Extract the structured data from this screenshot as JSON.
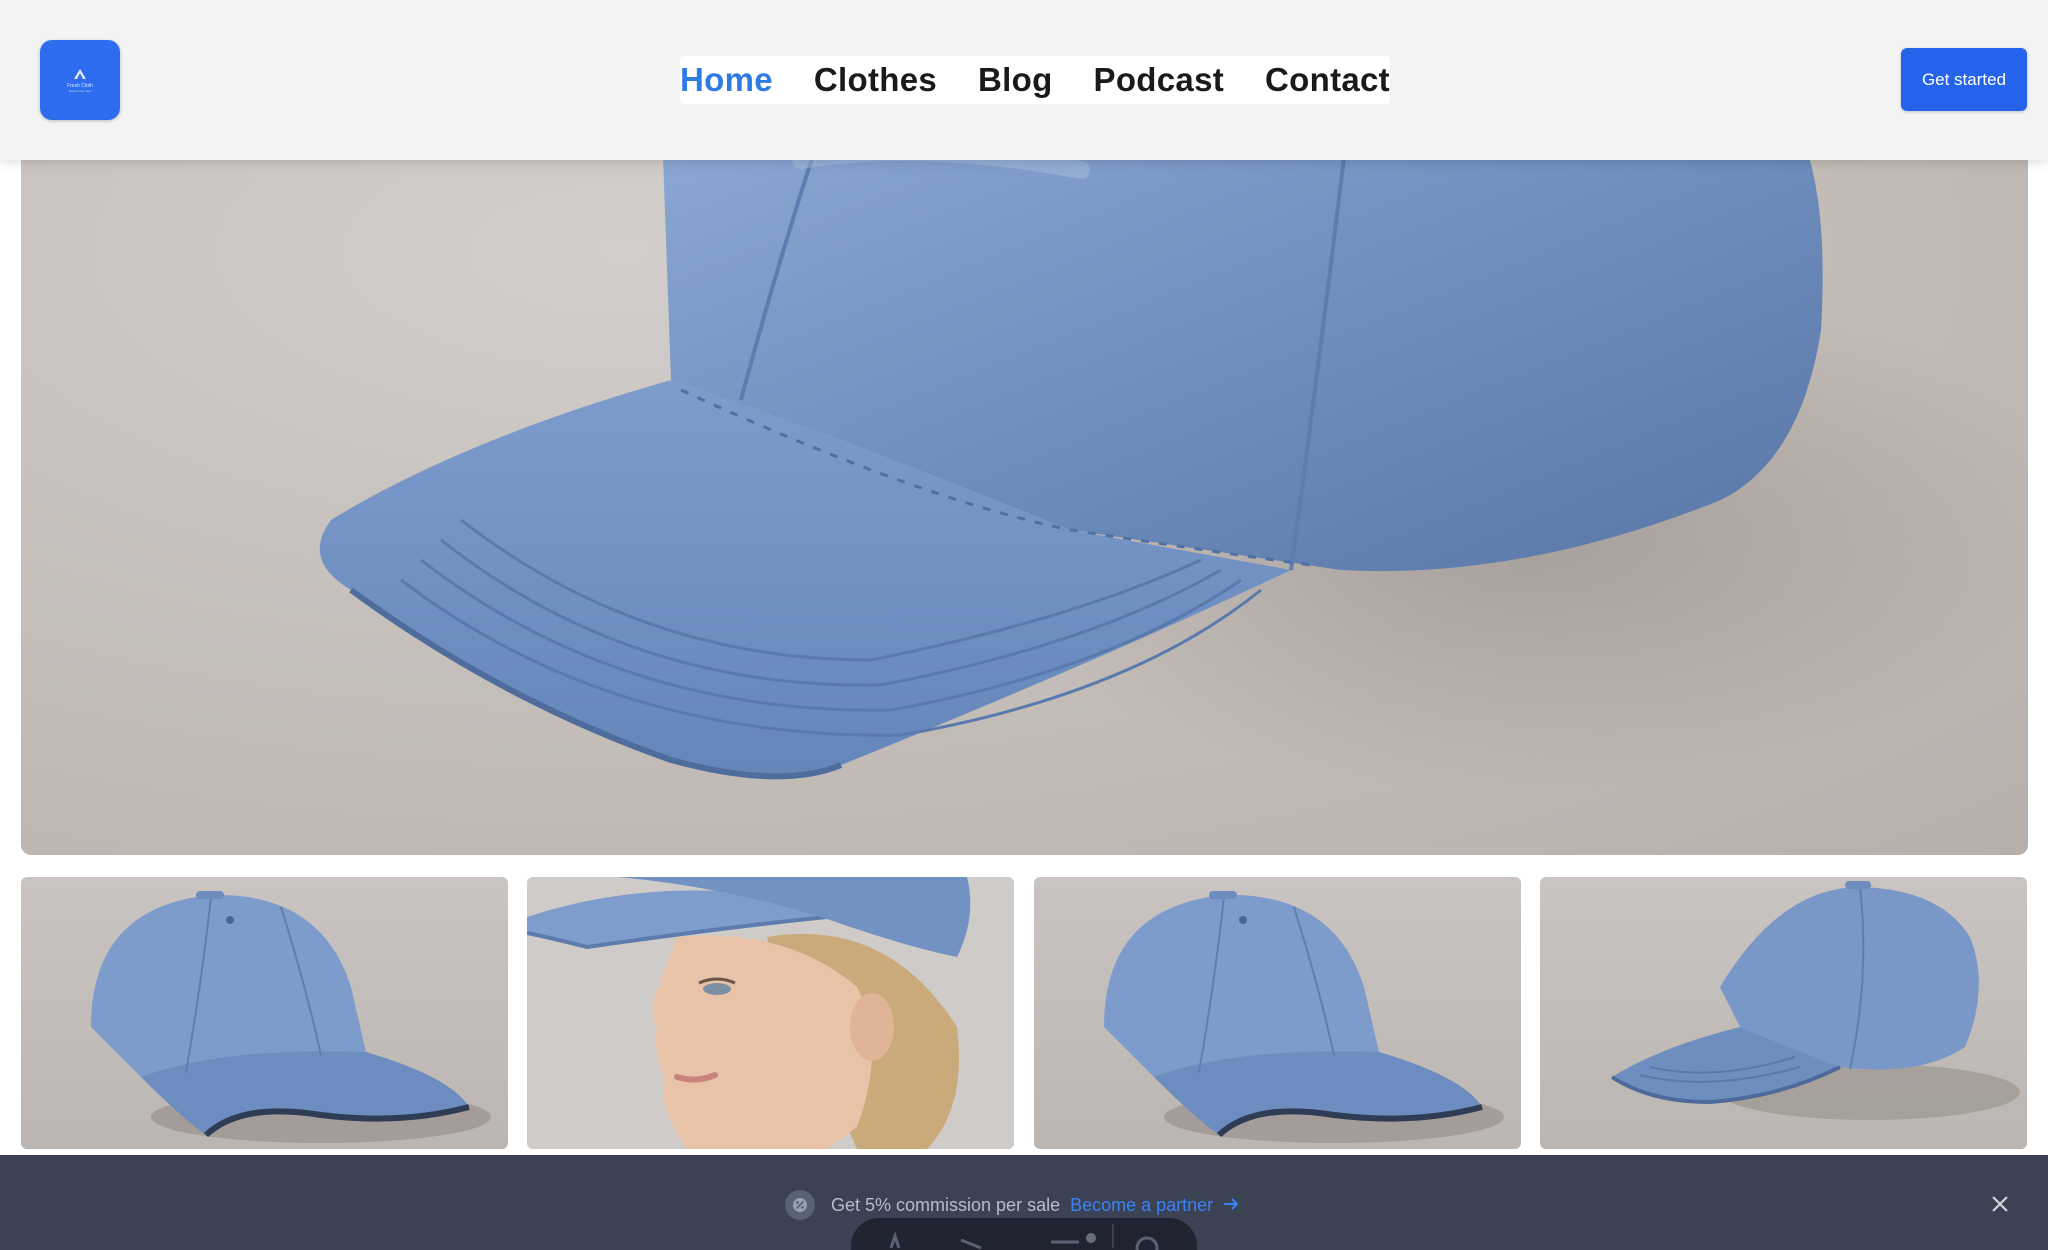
{
  "brand": {
    "logo_text": "Fresh Cloth",
    "logo_subtext": "Brand Logo Text",
    "accent_color": "#2e6df0"
  },
  "nav": {
    "items": [
      {
        "label": "Home",
        "active": true
      },
      {
        "label": "Clothes",
        "active": false
      },
      {
        "label": "Blog",
        "active": false
      },
      {
        "label": "Podcast",
        "active": false
      },
      {
        "label": "Contact",
        "active": false
      }
    ],
    "active_color": "#2f7be6"
  },
  "header": {
    "cta_label": "Get started",
    "cta_color": "#2563eb"
  },
  "gallery": {
    "hero_alt": "blue-baseball-cap-closeup",
    "thumbnails": [
      {
        "alt": "blue-cap-front-view"
      },
      {
        "alt": "woman-wearing-blue-cap"
      },
      {
        "alt": "blue-cap-front-view-2"
      },
      {
        "alt": "blue-cap-side-view"
      }
    ]
  },
  "banner": {
    "text": "Get 5% commission per sale",
    "link_label": "Become a partner",
    "icon": "percent-badge-icon",
    "link_color": "#3b82f6",
    "background": "#3a4254"
  }
}
